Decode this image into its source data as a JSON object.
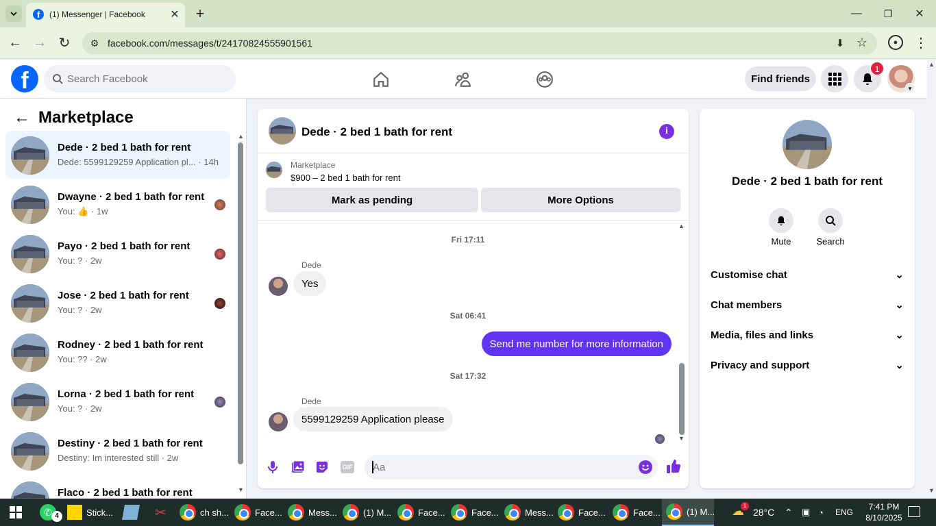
{
  "browser": {
    "tab_title": "(1) Messenger | Facebook",
    "url": "facebook.com/messages/t/24170824555901561"
  },
  "header": {
    "search_placeholder": "Search Facebook",
    "find_friends": "Find friends",
    "notification_count": "1"
  },
  "sidebar": {
    "title": "Marketplace",
    "conversations": [
      {
        "name": "Dede · 2 bed 1 bath for rent",
        "preview": "Dede: 5599129259 Application pl...",
        "time": "· 14h"
      },
      {
        "name": "Dwayne · 2 bed 1 bath for rent",
        "preview": "You: ",
        "time": "· 1w"
      },
      {
        "name": "Payo · 2 bed 1 bath for rent",
        "preview": "You: ? ",
        "time": "· 2w"
      },
      {
        "name": "Jose · 2 bed 1 bath for rent",
        "preview": "You: ? ",
        "time": "· 2w"
      },
      {
        "name": "Rodney · 2 bed 1 bath for rent",
        "preview": "You: ?? ",
        "time": "· 2w"
      },
      {
        "name": "Lorna · 2 bed 1 bath for rent",
        "preview": "You: ? ",
        "time": "· 2w"
      },
      {
        "name": "Destiny · 2 bed 1 bath for rent",
        "preview": "Destiny: Im interested still ",
        "time": "· 2w"
      },
      {
        "name": "Flaco · 2 bed 1 bath for rent",
        "preview": "",
        "time": ""
      }
    ]
  },
  "chat": {
    "title": "Dede · 2 bed 1 bath for rent",
    "listing_label": "Marketplace",
    "listing_detail": "$900 – 2 bed 1 bath for rent",
    "mark_pending": "Mark as pending",
    "more_options": "More Options",
    "messages": [
      {
        "timestamp": "Fri 17:11",
        "sender": "Dede",
        "text": "Yes"
      },
      {
        "timestamp": "Sat 06:41",
        "sender": "You",
        "text": "Send me number for more information"
      },
      {
        "timestamp": "Sat 17:32",
        "sender": "Dede",
        "text": "5599129259 Application please"
      }
    ],
    "composer_placeholder": "Aa"
  },
  "info_panel": {
    "title": "Dede · 2 bed 1 bath for rent",
    "mute": "Mute",
    "search": "Search",
    "sections": [
      "Customise chat",
      "Chat members",
      "Media, files and links",
      "Privacy and support"
    ]
  },
  "taskbar": {
    "items": [
      "Stick...",
      "ch sh...",
      "Face...",
      "Mess...",
      "(1) M...",
      "Face...",
      "Face...",
      "Mess...",
      "Face...",
      "Face...",
      "(1) M..."
    ],
    "whatsapp_badge": "4",
    "weather_badge": "1",
    "temperature": "28°C",
    "language": "ENG",
    "time": "7:41 PM",
    "date": "8/10/2025"
  },
  "colors": {
    "accent": "#7a2fe0",
    "bubble_out": "#6133f2",
    "fb_blue": "#0866ff"
  }
}
